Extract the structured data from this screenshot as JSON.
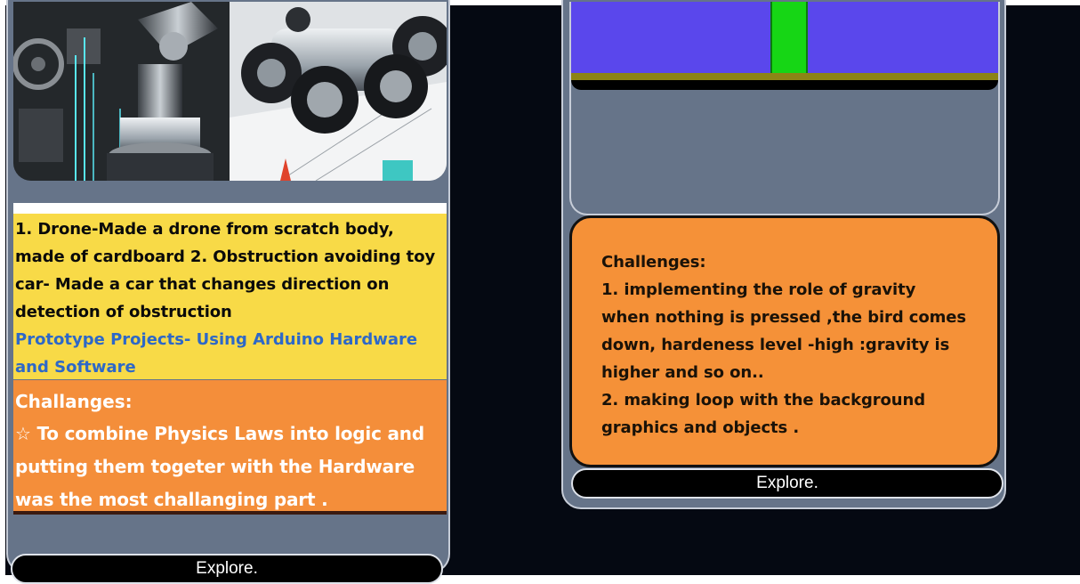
{
  "left_card": {
    "description": "1. Drone-Made a drone from scratch body, made of cardboard 2. Obstruction avoiding toy car- Made a car that changes direction on detection of obstruction",
    "subtitle": "Prototype Projects- Using Arduino Hardware and Software",
    "challenges_heading": "Challanges:",
    "challenges_text": "☆ To combine Physics Laws into logic and putting them togeter with the Hardware was the most challanging part .",
    "button_label": "Explore."
  },
  "right_card": {
    "challenges_heading": "Challenges:",
    "challenge_1": "1. implementing the role of gravity when nothing is pressed ,the bird comes down, hardeness level -high :gravity is higher and so on..",
    "challenge_2": "2. making loop with the background graphics and objects .",
    "button_label": "Explore."
  },
  "colors": {
    "page_background": "#050912",
    "card_background": "#667489",
    "yellow_panel": "#f8da47",
    "orange_panel": "#f48e3a",
    "link_blue": "#2d68c8",
    "game_sky": "#5a47ec",
    "game_pipe": "#16d615"
  },
  "icons": {
    "left_image": "robotics-arduino-illustration",
    "right_image": "flappy-bird-game-preview"
  }
}
